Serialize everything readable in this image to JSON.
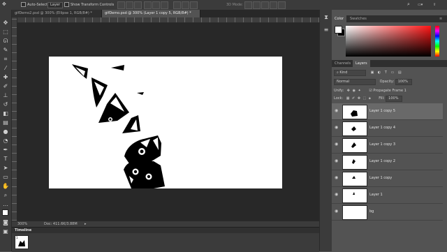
{
  "options_bar": {
    "auto_select_label": "Auto-Select:",
    "auto_select_value": "Layer",
    "show_transform_label": "Show Transform Controls",
    "mode_3d_label": "3D Mode:"
  },
  "tabs": [
    {
      "label": "gifDemo2.psd @ 300% (Ellipse 1, RGB/8#) *",
      "active": false
    },
    {
      "label": "gifDemo.psd @ 300% (Layer 1 copy 5, RGB/8#) *",
      "active": true
    }
  ],
  "status": {
    "zoom": "300%",
    "doc": "Doc: 411.6K/3.88M"
  },
  "timeline": {
    "title": "Timeline",
    "frame_label": "1"
  },
  "color_panel": {
    "tabs": [
      "Color",
      "Swatches"
    ],
    "active": "Color",
    "foreground": "#ffffff",
    "background": "#000000"
  },
  "layers_panel": {
    "tabs": [
      "Channels",
      "Layers"
    ],
    "active": "Layers",
    "filter_label": "Kind",
    "blend_mode": "Normal",
    "opacity_label": "Opacity:",
    "opacity_value": "100%",
    "unify_label": "Unify:",
    "propagate_label": "Propagate Frame 1",
    "lock_label": "Lock:",
    "fill_label": "Fill:",
    "fill_value": "100%",
    "layers": [
      {
        "name": "Layer 1 copy 5",
        "selected": true
      },
      {
        "name": "Layer 1 copy 4",
        "selected": false
      },
      {
        "name": "Layer 1 copy 3",
        "selected": false
      },
      {
        "name": "Layer 1 copy 2",
        "selected": false
      },
      {
        "name": "Layer 1 copy",
        "selected": false
      },
      {
        "name": "Layer 1",
        "selected": false
      },
      {
        "name": "bg",
        "selected": false
      }
    ]
  },
  "icons": {
    "tools": [
      "move-tool-icon",
      "marquee-tool-icon",
      "lasso-tool-icon",
      "quick-select-icon",
      "crop-tool-icon",
      "eyedropper-icon",
      "healing-brush-icon",
      "brush-tool-icon",
      "clone-stamp-icon",
      "history-brush-icon",
      "eraser-icon",
      "gradient-icon",
      "blur-tool-icon",
      "dodge-tool-icon",
      "pen-tool-icon",
      "type-tool-icon",
      "path-select-icon",
      "shape-tool-icon",
      "hand-tool-icon",
      "zoom-tool-icon",
      "more-tools-icon"
    ]
  }
}
